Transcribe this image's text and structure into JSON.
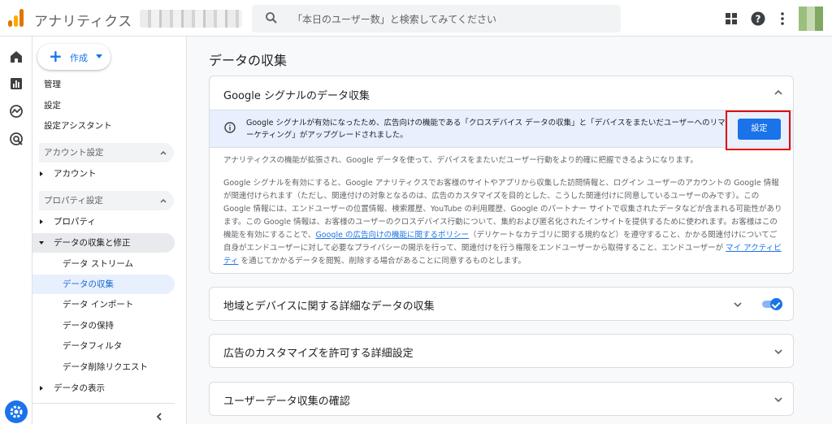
{
  "app": {
    "title": "アナリティクス",
    "search_placeholder": "「本日のユーザー数」と検索してみてください"
  },
  "colors": {
    "accent": "#1a73e8",
    "selected_bg": "#e8f0fe",
    "banner_bg": "#e8f0fe",
    "highlight": "#e00000"
  },
  "icons": {
    "logo": "analytics-logo-icon",
    "search": "search-icon",
    "apps": "apps-grid-icon",
    "help": "help-icon",
    "more": "more-vert-icon",
    "home": "home-icon",
    "reports": "reports-icon",
    "explore": "explore-icon",
    "advertising": "advertising-icon",
    "admin": "settings-gear-icon"
  },
  "sidebar": {
    "create_label": "作成",
    "items": {
      "admin": "管理",
      "settings": "設定",
      "setup_assistant": "設定アシスタント",
      "account_settings": "アカウント設定",
      "account": "アカウント",
      "property_settings": "プロパティ設定",
      "property": "プロパティ",
      "data_collection_modification": "データの収集と修正",
      "data_streams": "データ ストリーム",
      "data_collection": "データの収集",
      "data_import": "データ インポート",
      "data_retention": "データの保持",
      "data_filters": "データフィルタ",
      "data_deletion_requests": "データ削除リクエスト",
      "data_display": "データの表示"
    }
  },
  "main": {
    "page_title": "データの収集",
    "signals_card": {
      "title": "Google シグナルのデータ収集",
      "banner_text": "Google シグナルが有効になったため、広告向けの機能である「クロスデバイス データの収集」と「デバイスをまたいだユーザーへのリマーケティング」がアップグレードされました。",
      "settings_button": "設定",
      "para1": "アナリティクスの機能が拡張され、Google データを使って、デバイスをまたいだユーザー行動をより的確に把握できるようになります。",
      "para2_before_link": "Google シグナルを有効にすると、Google アナリティクスでお客様のサイトやアプリから収集した訪問情報と、ログイン ユーザーのアカウントの Google 情報が関連付けられます（ただし、関連付けの対象となるのは、広告のカスタマイズを目的とした、こうした関連付けに同意しているユーザーのみです）。この Google 情報には、エンドユーザーの位置情報、検索履歴、YouTube の利用履歴、Google のパートナー サイトで収集されたデータなどが含まれる可能性があります。この Google 情報は、お客様のユーザーのクロスデバイス行動について、集約および匿名化されたインサイトを提供するために使われます。お客様はこの機能を有効にすることで、",
      "policy_link": "Google の広告向けの機能に関するポリシー",
      "para2_middle": "（デリケートなカテゴリに関する規約など）を遵守すること、かかる関連付けについてご自身がエンドユーザーに対して必要なプライバシーの開示を行って、関連付けを行う権限をエンドユーザーから取得すること、エンドユーザーが ",
      "activity_link": "マイ アクティビティ",
      "para2_after_link": " を通じてかかるデータを閲覧、削除する場合があることに同意するものとします。"
    },
    "granular_card": {
      "title": "地域とデバイスに関する詳細なデータの収集",
      "toggle_on": true
    },
    "ads_personalization_card": {
      "title": "広告のカスタマイズを許可する詳細設定"
    },
    "user_data_card": {
      "title": "ユーザーデータ収集の確認"
    }
  }
}
